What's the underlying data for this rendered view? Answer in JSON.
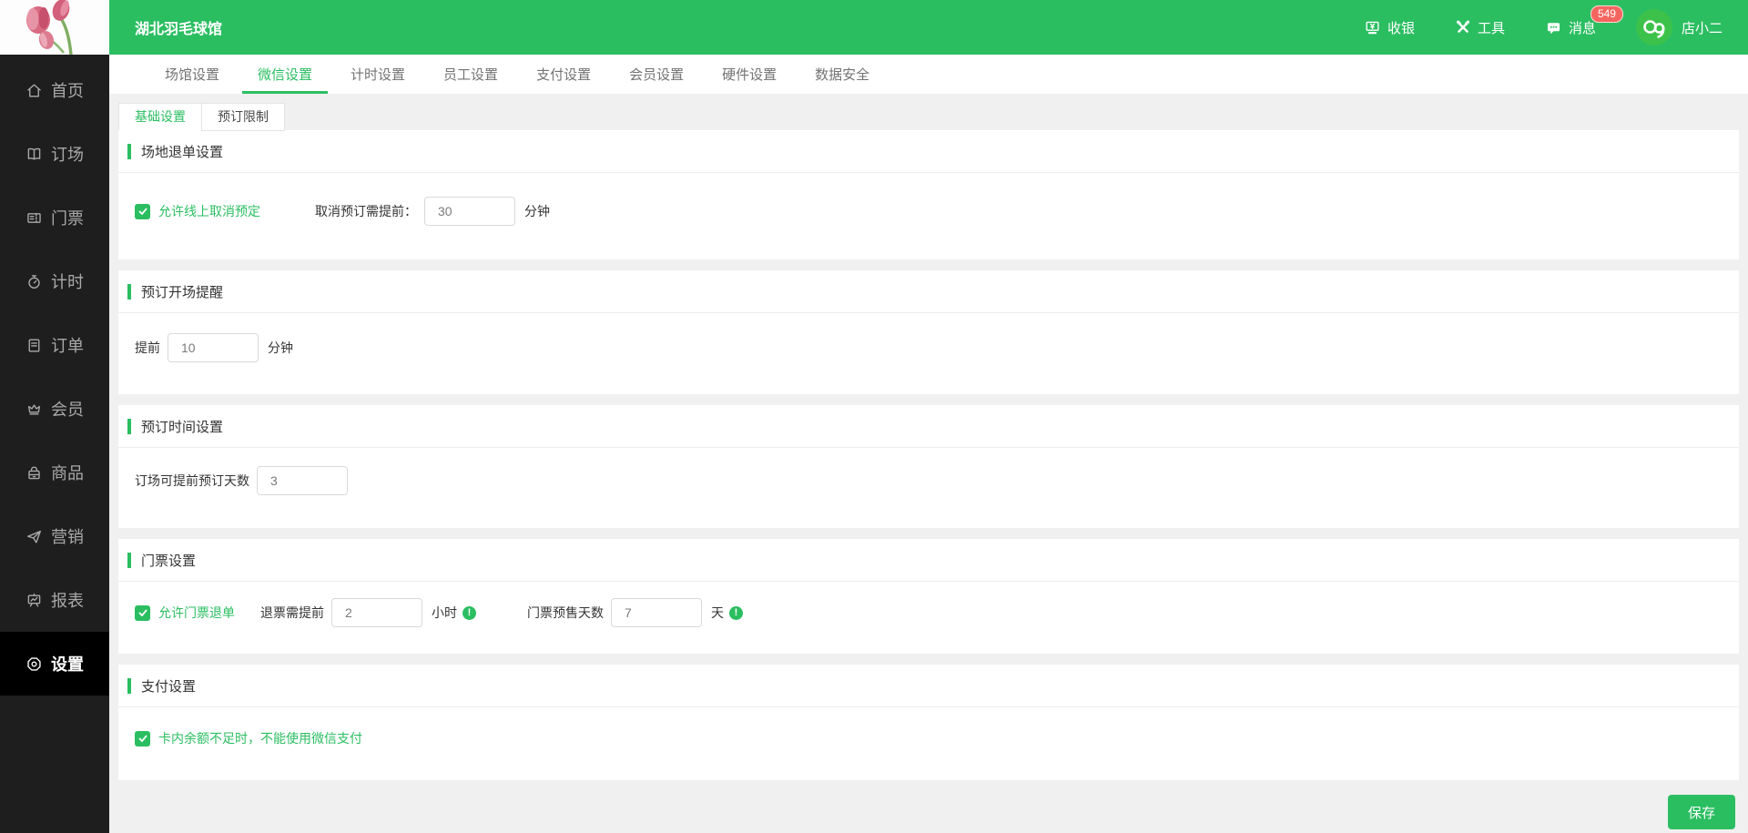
{
  "colors": {
    "accent_green": "#2bbe61",
    "avatar_green": "#3cc24a",
    "badge_red": "#f5655f",
    "sidebar_bg": "#1e1e1e",
    "sidebar_active_bg": "#000000",
    "page_bg": "#f0f0f0"
  },
  "header": {
    "title": "湖北羽毛球馆",
    "cashier": {
      "label": "收银",
      "icon": "cashier-icon"
    },
    "tools": {
      "label": "工具",
      "icon": "tools-icon"
    },
    "messages": {
      "label": "消息",
      "icon": "message-icon",
      "badge": "549"
    },
    "user": {
      "name": "店小二",
      "icon": "avatar-cloud-logo"
    }
  },
  "sidebar": {
    "items": [
      {
        "label": "首页",
        "icon": "home-icon",
        "active": false
      },
      {
        "label": "订场",
        "icon": "court-icon",
        "active": false
      },
      {
        "label": "门票",
        "icon": "ticket-icon",
        "active": false
      },
      {
        "label": "计时",
        "icon": "timer-icon",
        "active": false
      },
      {
        "label": "订单",
        "icon": "order-icon",
        "active": false
      },
      {
        "label": "会员",
        "icon": "member-icon",
        "active": false
      },
      {
        "label": "商品",
        "icon": "goods-icon",
        "active": false
      },
      {
        "label": "营销",
        "icon": "marketing-icon",
        "active": false
      },
      {
        "label": "报表",
        "icon": "report-icon",
        "active": false
      },
      {
        "label": "设置",
        "icon": "settings-icon",
        "active": true
      }
    ]
  },
  "tabs": {
    "active": "微信设置",
    "items": [
      {
        "label": "场馆设置"
      },
      {
        "label": "微信设置"
      },
      {
        "label": "计时设置"
      },
      {
        "label": "员工设置"
      },
      {
        "label": "支付设置"
      },
      {
        "label": "会员设置"
      },
      {
        "label": "硬件设置"
      },
      {
        "label": "数据安全"
      }
    ]
  },
  "subtabs": {
    "active": "基础设置",
    "items": [
      {
        "label": "基础设置"
      },
      {
        "label": "预订限制"
      }
    ]
  },
  "sections": {
    "refund": {
      "title": "场地退单设置",
      "checkbox": {
        "label": "允许线上取消预定",
        "checked": true
      },
      "field": {
        "label": "取消预订需提前：",
        "value": "30",
        "unit": "分钟"
      }
    },
    "remind": {
      "title": "预订开场提醒",
      "field": {
        "label": "提前",
        "value": "10",
        "unit": "分钟"
      }
    },
    "booktime": {
      "title": "预订时间设置",
      "field": {
        "label": "订场可提前预订天数",
        "value": "3"
      }
    },
    "ticket": {
      "title": "门票设置",
      "checkbox": {
        "label": "允许门票退单",
        "checked": true
      },
      "field1": {
        "label": "退票需提前",
        "value": "2",
        "unit": "小时",
        "info": "info-icon"
      },
      "field2": {
        "label": "门票预售天数",
        "value": "7",
        "unit": "天",
        "info": "info-icon"
      }
    },
    "pay": {
      "title": "支付设置",
      "checkbox": {
        "label": "卡内余额不足时，不能使用微信支付",
        "checked": true
      }
    }
  },
  "save_label": "保存"
}
